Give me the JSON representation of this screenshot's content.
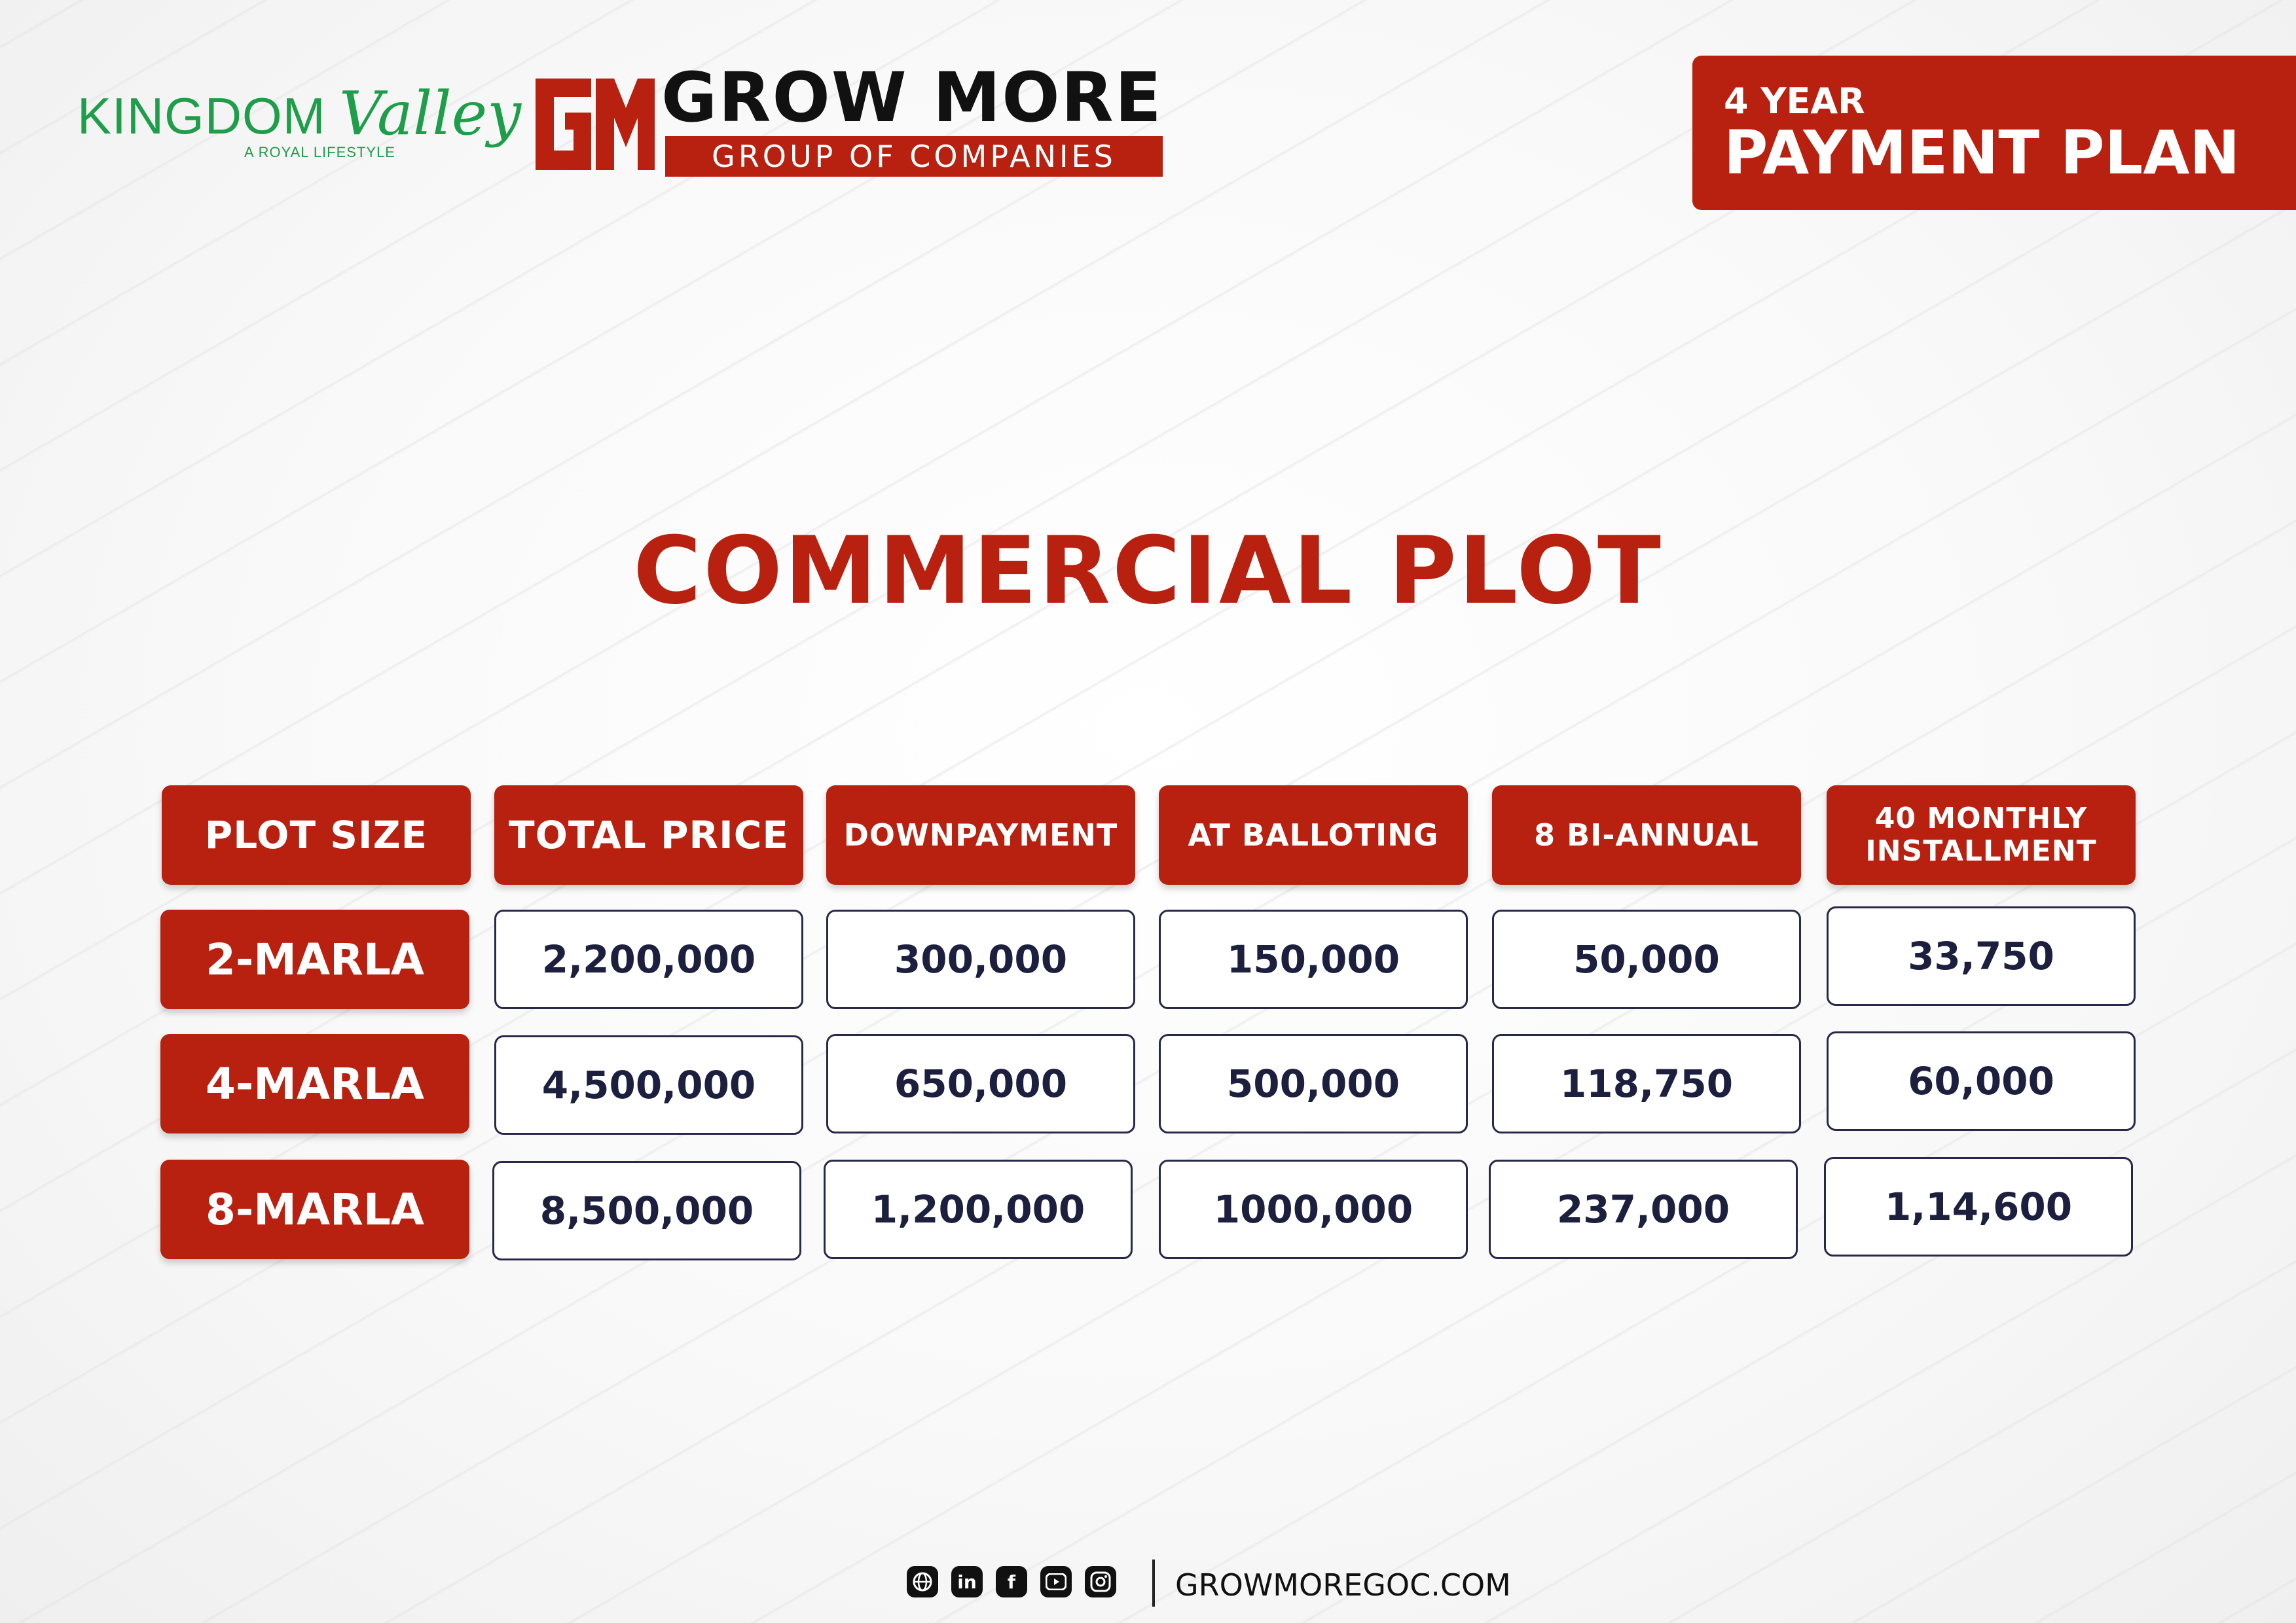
{
  "brand": {
    "kingdom_word": "KINGDOM",
    "valley_word": "Valley",
    "tagline": "A ROYAL LIFESTYLE",
    "gm_monogram": "GM",
    "company_name": "GROW MORE",
    "company_sub": "GROUP OF COMPANIES"
  },
  "plan": {
    "years": "4 YEAR",
    "title": "PAYMENT PLAN"
  },
  "heading": "COMMERCIAL PLOT",
  "table": {
    "headers": [
      "PLOT SIZE",
      "TOTAL PRICE",
      "DOWNPAYMENT",
      "AT BALLOTING",
      "8 BI-ANNUAL",
      "40 MONTHLY INSTALLMENT"
    ],
    "header_monthly_line1": "40 MONTHLY",
    "header_monthly_line2": "INSTALLMENT",
    "rows": [
      {
        "size": "2-MARLA",
        "values": [
          "2,200,000",
          "300,000",
          "150,000",
          "50,000",
          "33,750"
        ]
      },
      {
        "size": "4-MARLA",
        "values": [
          "4,500,000",
          "650,000",
          "500,000",
          "118,750",
          "60,000"
        ]
      },
      {
        "size": "8-MARLA",
        "values": [
          "8,500,000",
          "1,200,000",
          "1000,000",
          "237,000",
          "1,14,600"
        ]
      }
    ]
  },
  "footer": {
    "icons": [
      "globe-icon",
      "linkedin-icon",
      "facebook-icon",
      "youtube-icon",
      "instagram-icon"
    ],
    "website": "GROWMOREGOC.COM"
  },
  "colors": {
    "brand_red": "#b8200f",
    "brand_green": "#1e9e4a",
    "navy": "#1d1f3f"
  }
}
